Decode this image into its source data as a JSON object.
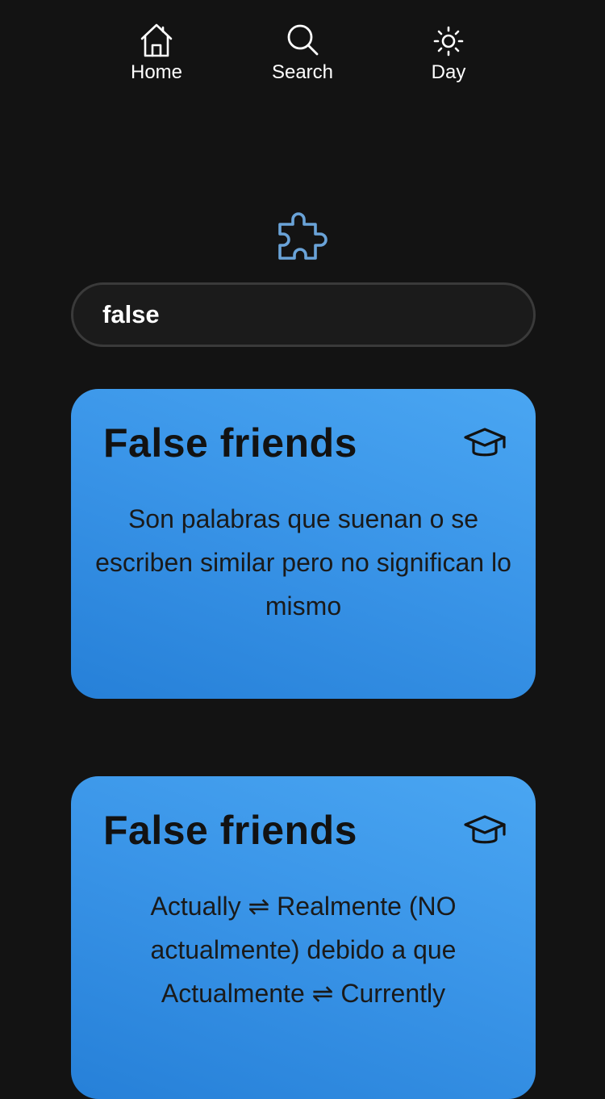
{
  "nav": {
    "home": {
      "label": "Home",
      "icon": "home-icon"
    },
    "search": {
      "label": "Search",
      "icon": "search-icon"
    },
    "day": {
      "label": "Day",
      "icon": "sun-icon"
    }
  },
  "logo": {
    "icon": "puzzle-icon",
    "color": "#6aa3d8"
  },
  "search": {
    "value": "false"
  },
  "cards": [
    {
      "title": "False friends",
      "icon": "graduation-cap-icon",
      "text": "Son palabras que suenan o se escriben similar pero no significan lo mismo"
    },
    {
      "title": "False friends",
      "icon": "graduation-cap-icon",
      "text": "Actually ⇌ Realmente (NO actualmente) debido a que Actualmente ⇌ Currently"
    }
  ],
  "colors": {
    "background": "#131313",
    "card_gradient_start": "#4aa6f2",
    "card_gradient_end": "#2680d8"
  }
}
